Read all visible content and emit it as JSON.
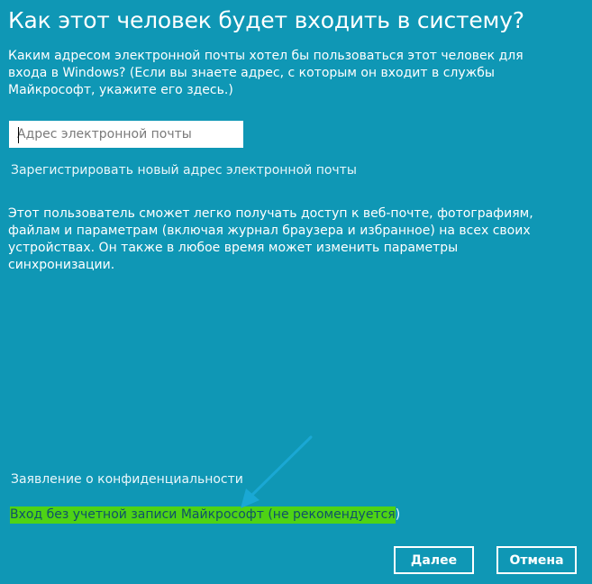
{
  "page": {
    "title": "Как этот человек будет входить в систему?",
    "intro_text": "Каким адресом электронной почты хотел бы пользоваться этот человек для входа в Windows? (Если вы знаете адрес, с которым он входит в службы Майкрософт, укажите его здесь.)"
  },
  "email_field": {
    "placeholder": "Адрес электронной почты",
    "value": ""
  },
  "links": {
    "register_new": "Зарегистрировать новый адрес электронной почты",
    "privacy": "Заявление о конфиденциальности",
    "no_account_highlighted": "Вход без учетной записи Майкрософт (не рекомендуется",
    "no_account_tail": ")"
  },
  "description": "Этот пользователь сможет легко получать доступ к веб-почте, фотографиям, файлам и параметрам (включая журнал браузера и избранное) на всех своих устройствах. Он также в любое время может изменить параметры синхронизации.",
  "buttons": {
    "next": "Далее",
    "cancel": "Отмена"
  },
  "colors": {
    "background": "#0f97b5",
    "highlight": "#4ed315",
    "arrow": "#1aa8d4"
  },
  "icons": {
    "annotation_arrow": "arrow-down-left-icon"
  }
}
